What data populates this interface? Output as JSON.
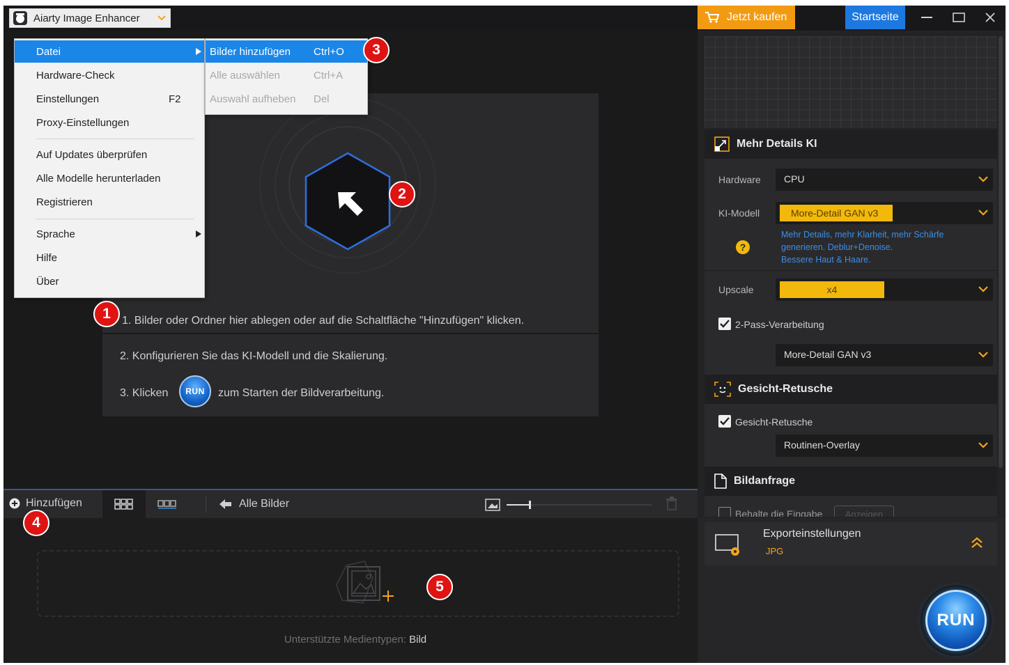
{
  "app": {
    "title": "Aiarty Image Enhancer"
  },
  "header": {
    "buy_label": "Jetzt kaufen",
    "home_label": "Startseite"
  },
  "menu_main": {
    "items": [
      {
        "label": "Datei",
        "shortcut": "",
        "submenu": true
      },
      {
        "label": "Hardware-Check",
        "shortcut": ""
      },
      {
        "label": "Einstellungen",
        "shortcut": "F2"
      },
      {
        "label": "Proxy-Einstellungen",
        "shortcut": ""
      },
      {
        "label": "Auf Updates überprüfen",
        "shortcut": ""
      },
      {
        "label": "Alle Modelle herunterladen",
        "shortcut": ""
      },
      {
        "label": "Registrieren",
        "shortcut": ""
      },
      {
        "label": "Sprache",
        "shortcut": "",
        "submenu": true
      },
      {
        "label": "Hilfe",
        "shortcut": ""
      },
      {
        "label": "Über",
        "shortcut": ""
      }
    ]
  },
  "menu_datei": {
    "items": [
      {
        "label": "Bilder hinzufügen",
        "shortcut": "Ctrl+O"
      },
      {
        "label": "Alle auswählen",
        "shortcut": "Ctrl+A"
      },
      {
        "label": "Auswahl aufheben",
        "shortcut": "Del"
      }
    ]
  },
  "instructions": {
    "step1": "1. Bilder oder Ordner hier ablegen oder auf die Schaltfläche \"Hinzufügen\" klicken.",
    "step2": "2. Konfigurieren Sie das KI-Modell und die Skalierung.",
    "step3_before": "3. Klicken",
    "step3_after": "zum Starten der Bildverarbeitung.",
    "run_small_label": "RUN"
  },
  "badges": [
    "1",
    "2",
    "3",
    "4",
    "5"
  ],
  "toolbar": {
    "add_label": "Hinzufügen",
    "all_images_label": "Alle Bilder"
  },
  "dropzone": {
    "media_prefix": "Unterstützte Medientypen:",
    "media_type": "Bild"
  },
  "settings": {
    "mehr_details": {
      "title": "Mehr Details KI",
      "hardware_label": "Hardware",
      "hardware_value": "CPU",
      "model_label": "KI-Modell",
      "model_value": "More-Detail GAN  v3",
      "model_desc_1": "Mehr Details, mehr Klarheit, mehr Schärfe",
      "model_desc_2": "generieren. Deblur+Denoise.",
      "model_desc_3": "Bessere Haut & Haare.",
      "upscale_label": "Upscale",
      "upscale_value": "x4",
      "twopass_label": "2-Pass-Verarbeitung",
      "twopass_checked": true,
      "twopass_model": "More-Detail GAN  v3"
    },
    "gesicht": {
      "title": "Gesicht-Retusche",
      "checkbox_label": "Gesicht-Retusche",
      "checked": true,
      "mode_value": "Routinen-Overlay"
    },
    "bildanfrage": {
      "title": "Bildanfrage",
      "keep_label": "Behalte die Eingabe",
      "show_button": "Anzeigen"
    },
    "export": {
      "title": "Exporteinstellungen",
      "format": "JPG"
    },
    "run_label": "RUN"
  },
  "colors": {
    "accent_orange": "#f29b12",
    "accent_blue": "#1d78e0",
    "badge_red": "#e01313",
    "tag_yellow": "#f2b90c"
  }
}
